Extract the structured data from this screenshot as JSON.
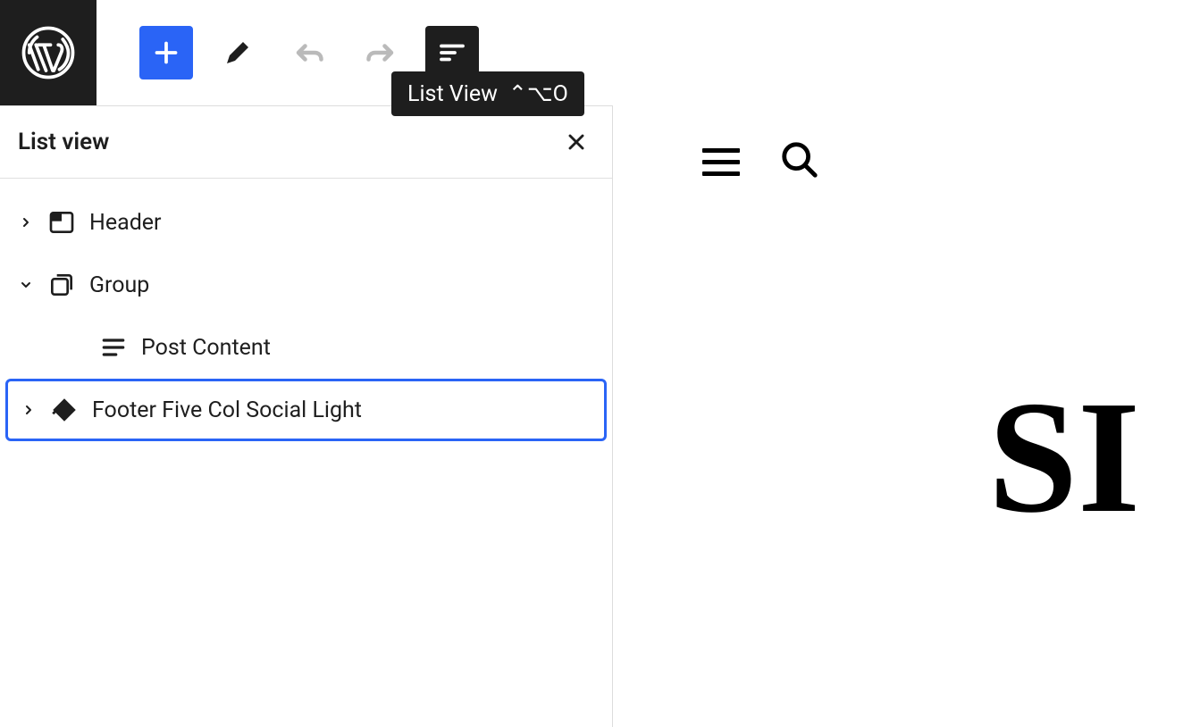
{
  "toolbar": {
    "logo": "wordpress"
  },
  "tooltip": {
    "label": "List View",
    "shortcut": "⌃⌥O"
  },
  "sidebar": {
    "title": "List view",
    "items": [
      {
        "label": "Header",
        "expanded": false,
        "icon": "header"
      },
      {
        "label": "Group",
        "expanded": true,
        "icon": "group"
      },
      {
        "label": "Post Content",
        "icon": "post-content",
        "nested": true
      },
      {
        "label": "Footer Five Col Social Light",
        "expanded": false,
        "icon": "reusable",
        "selected": true
      }
    ]
  },
  "canvas": {
    "big_text": "SI"
  }
}
